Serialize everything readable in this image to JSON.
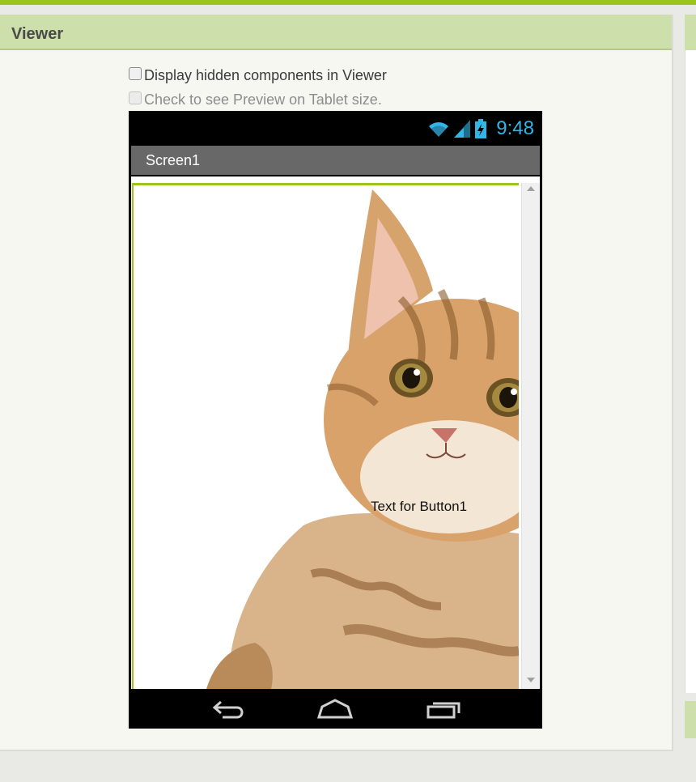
{
  "viewer": {
    "title": "Viewer",
    "display_hidden_label": "Display hidden components in Viewer",
    "display_hidden_checked": false,
    "tablet_preview_label": "Check to see Preview on Tablet size.",
    "tablet_preview_checked": false
  },
  "phone": {
    "status": {
      "time": "9:48",
      "icons": [
        "wifi-icon",
        "signal-icon",
        "battery-icon"
      ]
    },
    "screen_title": "Screen1",
    "image": "kitten-photo",
    "button1_text": "Text for Button1",
    "nav": [
      "back-icon",
      "home-icon",
      "recent-apps-icon"
    ]
  },
  "colors": {
    "accent": "#9ac41e",
    "header_bg": "#cddfaa",
    "action_bar": "#686868",
    "status_icons": "#33b5e5"
  }
}
